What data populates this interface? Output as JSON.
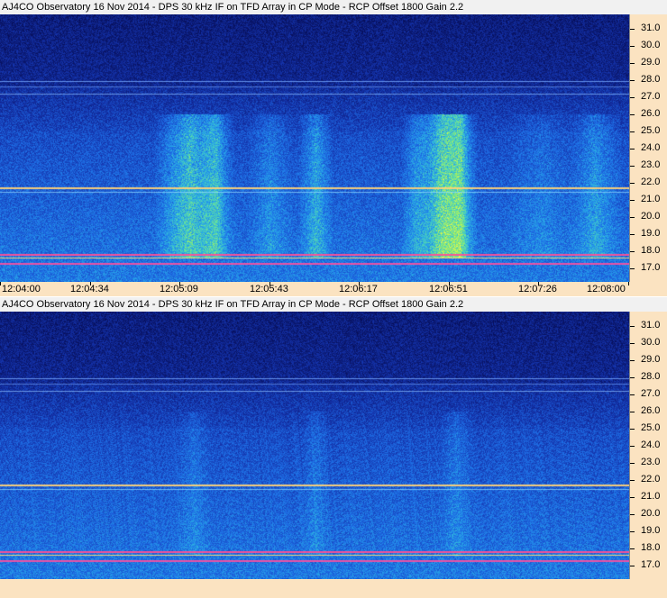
{
  "panels": [
    {
      "title": "AJ4CO Observatory 16 Nov 2014 - DPS 30 kHz IF on TFD Array in CP Mode - RCP      Offset 1800  Gain 2.2",
      "freq_labels": [
        "31.0",
        "30.0",
        "29.0",
        "28.0",
        "27.0",
        "26.0",
        "25.0",
        "24.0",
        "23.0",
        "22.0",
        "21.0",
        "20.0",
        "19.0",
        "18.0",
        "17.0"
      ],
      "time_labels": [
        "12:04:00",
        "12:04:34",
        "12:05:09",
        "12:05:43",
        "12:06:17",
        "12:06:51",
        "12:07:26",
        "12:08:00"
      ],
      "intensity": "strong"
    },
    {
      "title": "AJ4CO Observatory 16 Nov 2014 - DPS 30 kHz IF on TFD Array in CP Mode - RCP      Offset 1800  Gain 2.2",
      "freq_labels": [
        "31.0",
        "30.0",
        "29.0",
        "28.0",
        "27.0",
        "26.0",
        "25.0",
        "24.0",
        "23.0",
        "22.0",
        "21.0",
        "20.0",
        "19.0",
        "18.0",
        "17.0"
      ],
      "time_labels": [],
      "intensity": "weak"
    }
  ],
  "colors": {
    "axis_background": "#fbe3c1",
    "title_background": "#f1f1f1",
    "spectrogram_dark": "#0a1860",
    "spectrogram_mid": "#1e5ad6",
    "spectrogram_bright": "#6ee0a0",
    "interference_line": "#ff4080"
  }
}
